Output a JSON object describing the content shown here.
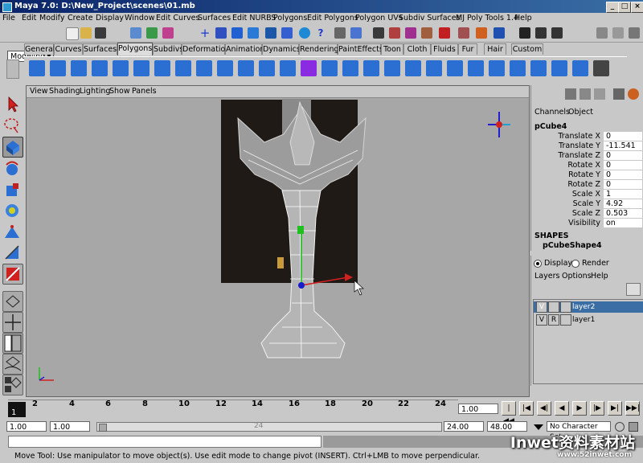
{
  "window": {
    "title": "Maya 7.0: D:\\New_Project\\scenes\\01.mb"
  },
  "menubar": [
    "File",
    "Edit",
    "Modify",
    "Create",
    "Display",
    "Window",
    "Edit Curves",
    "Surfaces",
    "Edit NURBS",
    "Polygons",
    "Edit Polygons",
    "Polygon UVs",
    "Subdiv Surfaces",
    "MJ Poly Tools 1.4",
    "Help"
  ],
  "statusline": {
    "mode": "Modeling"
  },
  "shelf_tabs": [
    "General",
    "Curves",
    "Surfaces",
    "Polygons",
    "Subdivs",
    "Deformation",
    "Animation",
    "Dynamics",
    "Rendering",
    "PaintEffects",
    "Toon",
    "Cloth",
    "Fluids",
    "Fur",
    "Hair",
    "Custom"
  ],
  "shelf_active": "Polygons",
  "viewport_menu": [
    "View",
    "Shading",
    "Lighting",
    "Show",
    "Panels"
  ],
  "channel_box": {
    "tabs": [
      "Channels",
      "Object"
    ],
    "object_name": "pCube4",
    "attributes": [
      {
        "label": "Translate X",
        "value": "0"
      },
      {
        "label": "Translate Y",
        "value": "-11.541"
      },
      {
        "label": "Translate Z",
        "value": "0"
      },
      {
        "label": "Rotate X",
        "value": "0"
      },
      {
        "label": "Rotate Y",
        "value": "0"
      },
      {
        "label": "Rotate Z",
        "value": "0"
      },
      {
        "label": "Scale X",
        "value": "1"
      },
      {
        "label": "Scale Y",
        "value": "4.92"
      },
      {
        "label": "Scale Z",
        "value": "0.503"
      },
      {
        "label": "Visibility",
        "value": "on"
      }
    ],
    "shapes_header": "SHAPES",
    "shape_name": "pCubeShape4"
  },
  "layer_editor": {
    "display_label": "Display",
    "render_label": "Render",
    "menu": [
      "Layers",
      "Options",
      "Help"
    ],
    "layers": [
      {
        "v": "V",
        "r": "",
        "name": "layer2",
        "selected": true
      },
      {
        "v": "V",
        "r": "R",
        "name": "layer1",
        "selected": false
      }
    ]
  },
  "timeline": {
    "ticks": [
      "2",
      "4",
      "6",
      "8",
      "10",
      "12",
      "14",
      "16",
      "18",
      "20",
      "22",
      "24"
    ],
    "current_frame": "1",
    "current_time": "1.00"
  },
  "range": {
    "start": "1.00",
    "playback_start": "1.00",
    "slider_end_label": "24",
    "playback_end": "24.00",
    "end": "48.00",
    "character_set": "No Character Set"
  },
  "help_line": "Move Tool: Use manipulator to move object(s). Use edit mode to change pivot (INSERT).  Ctrl+LMB to move perpendicular.",
  "watermark": {
    "main": "Inwet资料素材站",
    "url": "www.52inwet.com"
  }
}
